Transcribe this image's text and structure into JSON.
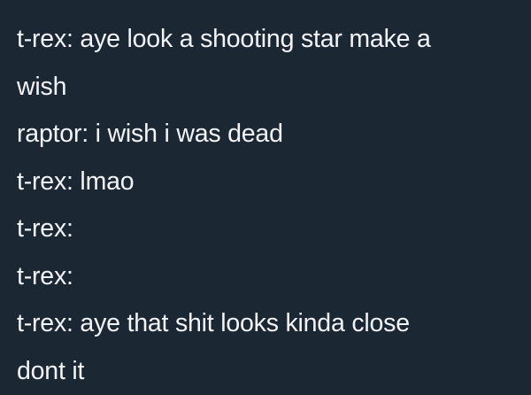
{
  "lines": [
    "t-rex: aye look a shooting star make a",
    "wish",
    "raptor: i wish i was dead",
    "t-rex: lmao",
    "t-rex:",
    "t-rex:",
    "t-rex: aye that shit looks kinda close",
    "dont it"
  ],
  "colors": {
    "background": "#1c2734",
    "text": "#f2f4f7"
  }
}
